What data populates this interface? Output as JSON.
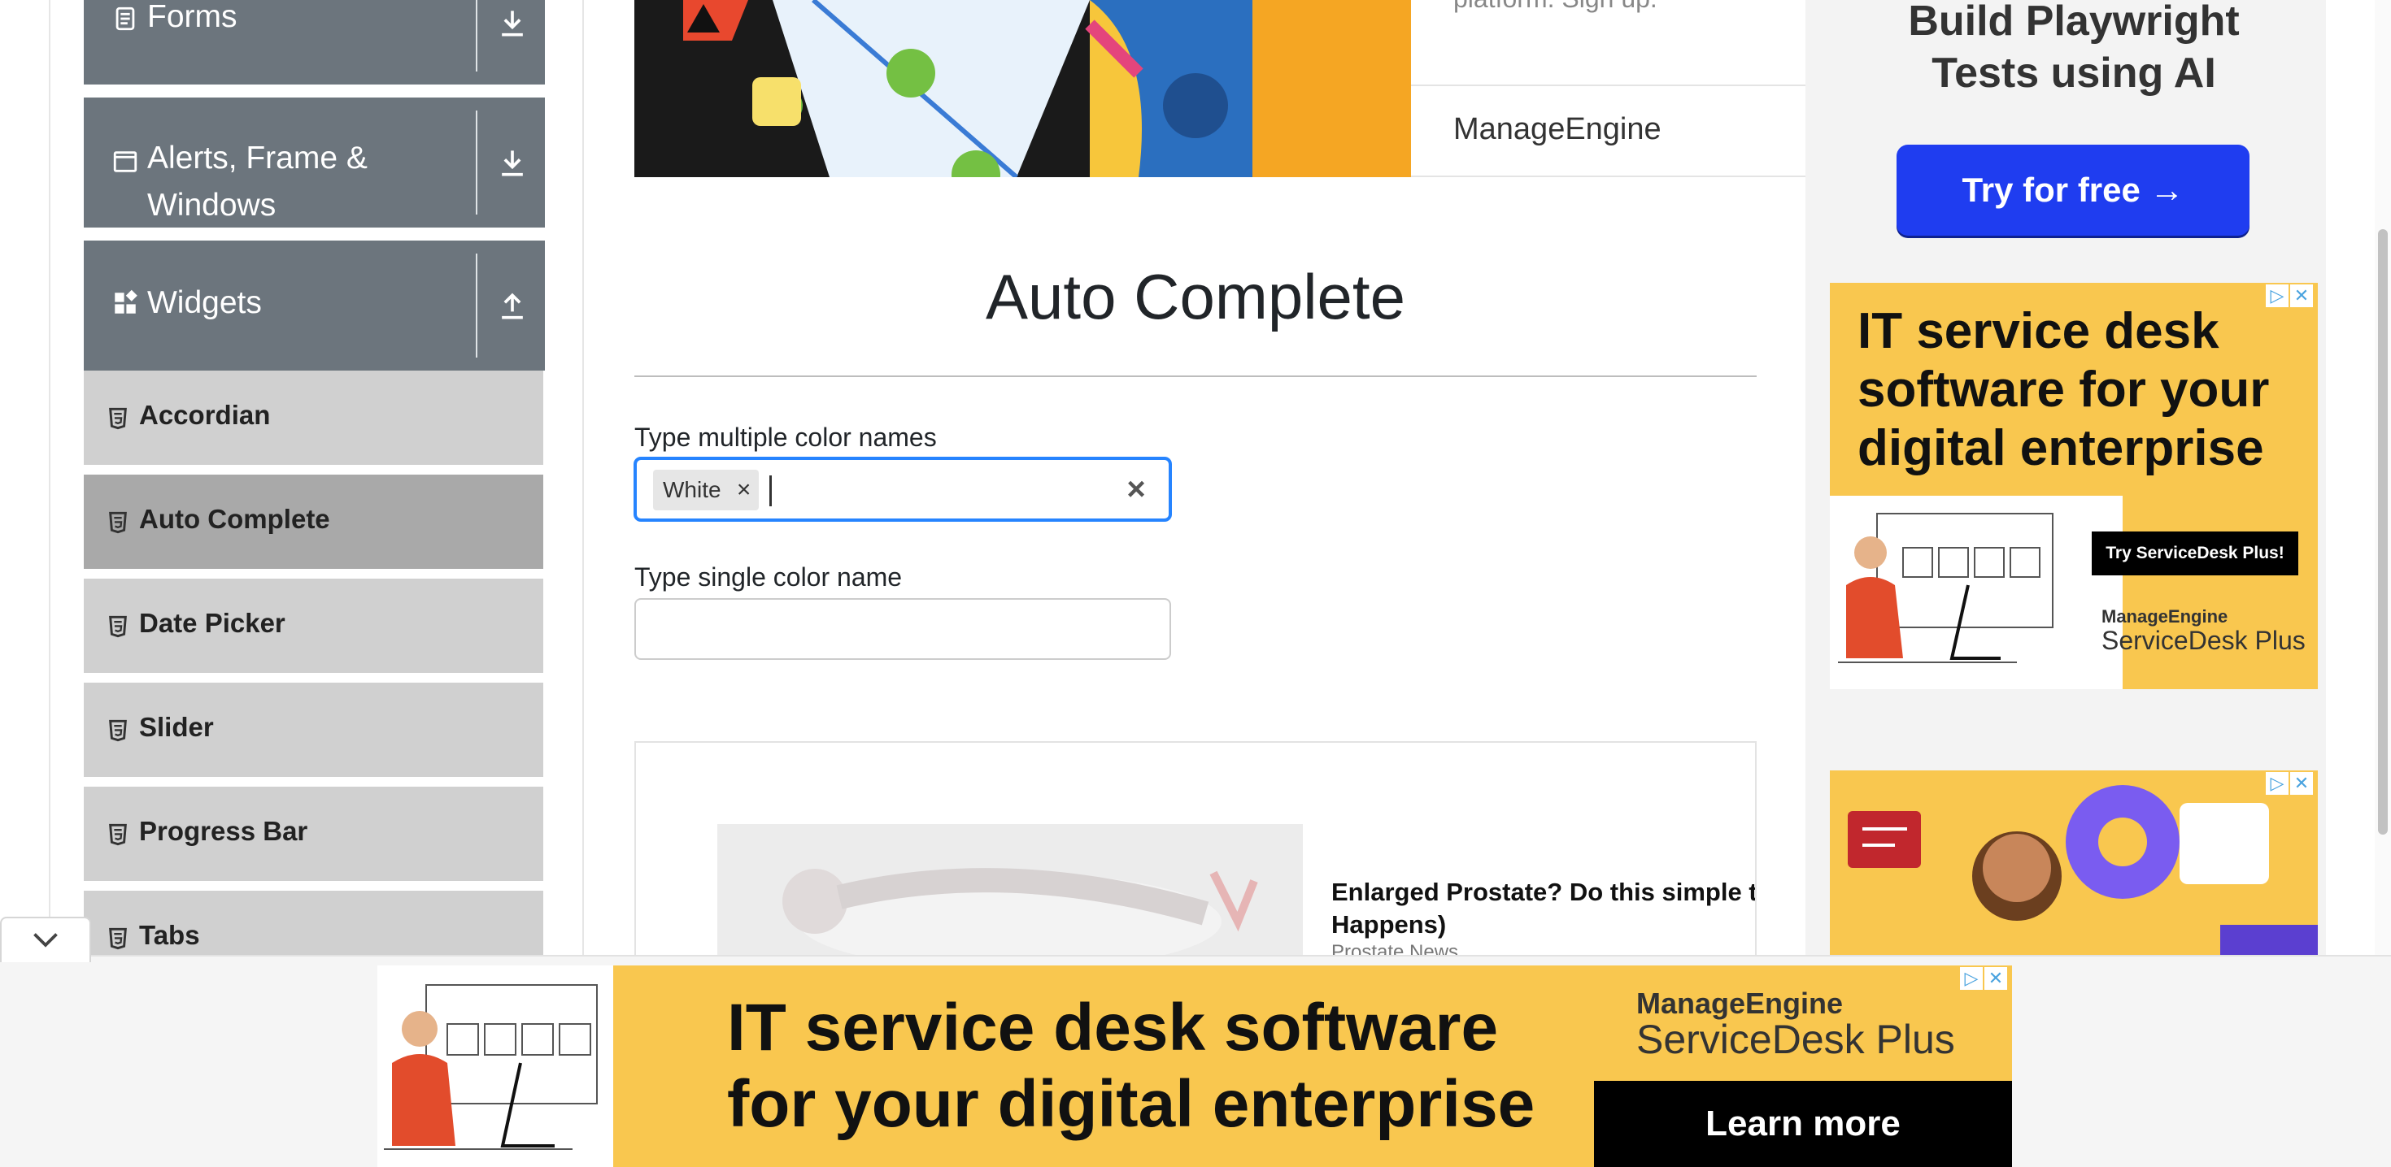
{
  "sidebar": {
    "groups": [
      {
        "label": "Forms"
      },
      {
        "label": "Alerts, Frame & Windows"
      },
      {
        "label": "Widgets"
      }
    ],
    "items": [
      {
        "label": "Accordian"
      },
      {
        "label": "Auto Complete"
      },
      {
        "label": "Date Picker"
      },
      {
        "label": "Slider"
      },
      {
        "label": "Progress Bar"
      },
      {
        "label": "Tabs"
      }
    ]
  },
  "hero": {
    "caption_top": "platform. Sign up.",
    "brand": "ManageEngine"
  },
  "main": {
    "title": "Auto Complete",
    "multi_label": "Type multiple color names",
    "multi_chip": "White",
    "multi_chip_remove": "×",
    "multi_clear": "×",
    "single_label": "Type single color name",
    "single_value": ""
  },
  "sponsored": {
    "headline": "Enlarged Prostate? Do this simple trick",
    "headline_line2": "Happens)",
    "source": "Prostate News"
  },
  "ads": {
    "playwright": {
      "title_line1": "Build Playwright",
      "title_line2": "Tests using AI",
      "button": "Try for free →"
    },
    "servicedesk": {
      "head_line1": "IT service desk",
      "head_line2": "software for your",
      "head_line3": "digital enterprise",
      "button": "Try ServiceDesk Plus!",
      "brand1": "ManageEngine",
      "brand2": "ServiceDesk Plus"
    },
    "bottom": {
      "head_line1": "IT service desk software",
      "head_line2": "for your digital enterprise",
      "brand1": "ManageEngine",
      "brand2": "ServiceDesk Plus",
      "button": "Learn more"
    }
  },
  "colors": {
    "sidebar_group": "#6c757d",
    "focus_border": "#2684ff",
    "ad_yellow": "#f9c74f",
    "cta_blue": "#1f3df0"
  }
}
